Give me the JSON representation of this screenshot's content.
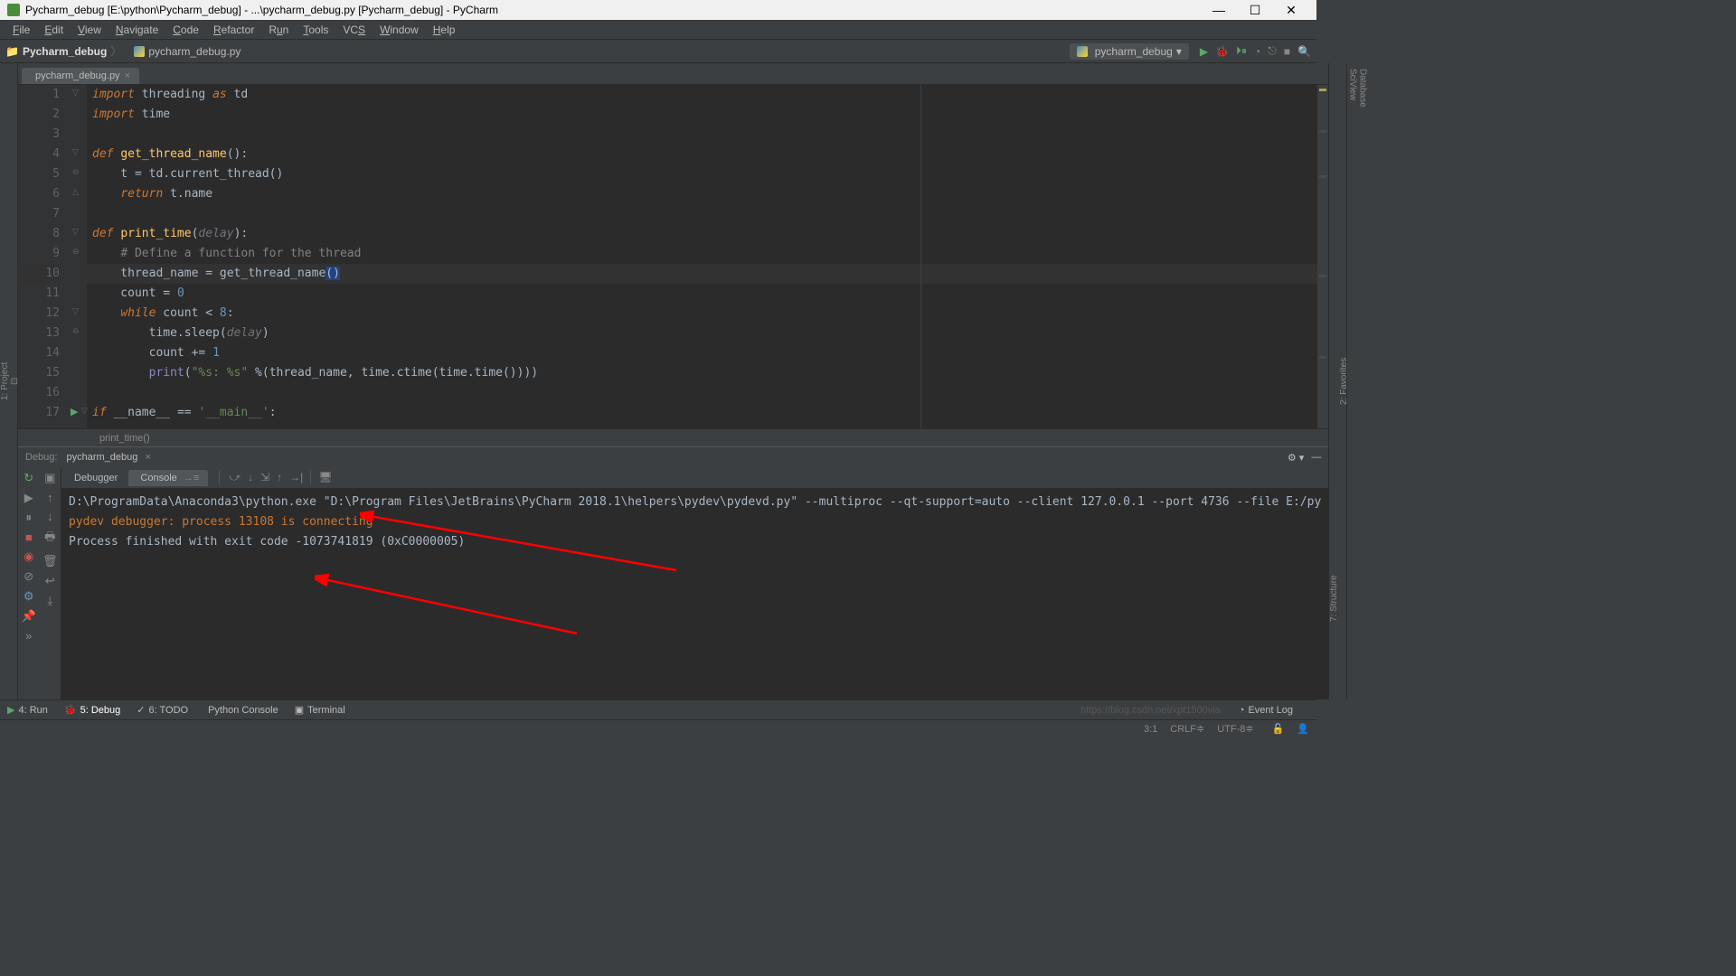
{
  "title": "Pycharm_debug [E:\\python\\Pycharm_debug] - ...\\pycharm_debug.py [Pycharm_debug] - PyCharm",
  "menu": [
    "File",
    "Edit",
    "View",
    "Navigate",
    "Code",
    "Refactor",
    "Run",
    "Tools",
    "VCS",
    "Window",
    "Help"
  ],
  "breadcrumb": {
    "root": "Pycharm_debug",
    "file": "pycharm_debug.py"
  },
  "run_config": "pycharm_debug",
  "tab": "pycharm_debug.py",
  "lines": [
    "1",
    "2",
    "3",
    "4",
    "5",
    "6",
    "7",
    "8",
    "9",
    "10",
    "11",
    "12",
    "13",
    "14",
    "15",
    "16",
    "17"
  ],
  "breadcrumb_fn": "print_time()",
  "debug": {
    "label": "Debug:",
    "name": "pycharm_debug",
    "tabs": [
      "Debugger",
      "Console"
    ],
    "console": {
      "l1": "D:\\ProgramData\\Anaconda3\\python.exe \"D:\\Program Files\\JetBrains\\PyCharm 2018.1\\helpers\\pydev\\pydevd.py\" --multiproc --qt-support=auto --client 127.0.0.1 --port 4736 --file E:/py",
      "l2": "pydev debugger: process 13108 is connecting",
      "l3": "",
      "l4": "",
      "l5": "Process finished with exit code -1073741819 (0xC0000005)"
    }
  },
  "bottom_tabs": {
    "run": "4: Run",
    "debug": "5: Debug",
    "todo": "6: TODO",
    "pyconsole": "Python Console",
    "terminal": "Terminal"
  },
  "event_log": "Event Log",
  "watermark": "https://blog.csdn.net/xpt1500via",
  "status": {
    "pos": "3:1",
    "le": "CRLF",
    "enc": "UTF-8"
  },
  "left_tools": [
    "1: Project"
  ],
  "left_tools2": [
    "7: Structure",
    "2: Favorites"
  ],
  "right_tools": [
    "SciView",
    "Database"
  ]
}
